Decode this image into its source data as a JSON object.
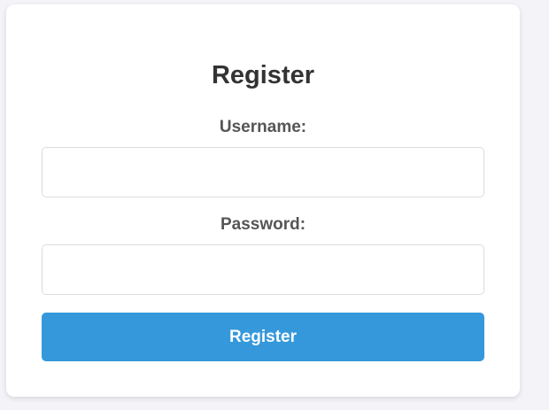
{
  "form": {
    "title": "Register",
    "username_label": "Username:",
    "username_value": "",
    "password_label": "Password:",
    "password_value": "",
    "submit_label": "Register"
  },
  "colors": {
    "page_background": "#f3f3f8",
    "card_background": "#ffffff",
    "button_background": "#3498db",
    "button_text": "#ffffff",
    "title_text": "#333333",
    "label_text": "#555555",
    "input_border": "#dcdcdc"
  }
}
